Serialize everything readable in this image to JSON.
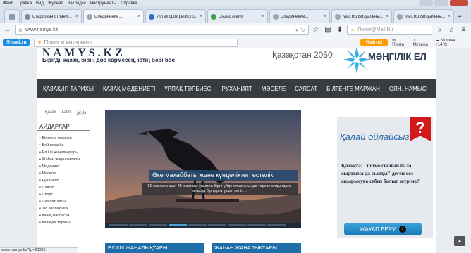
{
  "menubar": {
    "items": [
      "Файл",
      "Правка",
      "Вид",
      "Журнал",
      "Закладки",
      "Инструменты",
      "Справка"
    ]
  },
  "tabs": [
    {
      "label": "Стартовая страниц...",
      "color": "#7a8a9a"
    },
    {
      "label": "Соединение...",
      "color": "#9aa6b4",
      "active": true
    },
    {
      "label": "Истек срок регистр...",
      "color": "#2f6cc4"
    },
    {
      "label": "Qazaq Alemi",
      "color": "#3fa046"
    },
    {
      "label": "Соединение...",
      "color": "#9aa6b4"
    },
    {
      "label": "Mail.Ru Визуальны...",
      "color": "#9aa6b4"
    },
    {
      "label": "Mail.Ru Визуальны...",
      "color": "#9aa6b4"
    }
  ],
  "navbar": {
    "url": "www.namys.kz",
    "search_placeholder": "Поиск@Mail.Ru"
  },
  "mailru": {
    "logo": "@mail.ru",
    "search_placeholder": "Поиск в интернете",
    "find_label": "Найти!",
    "mail_label": "Почта",
    "music_label": "Музыка",
    "weather": "Москва +14°C"
  },
  "site": {
    "logo": "NAMYS.KZ",
    "tagline": "Бірігді, қазақ, бірің дос көрмесең, істің бәрі бос",
    "kz2050": "Қазақстан 2050",
    "star_title": "МӘҢГІЛІК ЕЛ",
    "nav": [
      "ҚАЗАҚИЯ ТАРИХЫ",
      "ҚАЗАҚ МӘДЕНИЕТІ",
      "ҰРПАҚ ТӘРБИЕСІ",
      "РУХАНИЯТ",
      "МӘСЕЛЕ",
      "САЯСАТ",
      "БІЛГЕНГЕ МАРЖАН",
      "ОЯН, НАМЫС"
    ],
    "langs": [
      "Қазақ",
      "Latin",
      "قازاق"
    ],
    "archive_head": "АЙДАРЛАР",
    "sections": [
      "Білгенге маржан",
      "Бейнежазба",
      "Ел іші жаңалықтары",
      "Жаһан жаңалықтары",
      "Мәдениет",
      "Мәселе",
      "Руханият",
      "Саясат",
      "Спорт",
      "Сөз патшасы",
      "Тіл кеплек жоқ",
      "Қазақ баспасөз",
      "Қазақия тарихы"
    ],
    "slide_caption": "Әке махаббаты және күнделіктегі естелік",
    "slide_desc": "80 жастағы шал 45 жастағы ұлымен бірге үйде отырғанында терезе алдындағы ағашқа бір қарға ұшып келіп...",
    "quiz_title": "Қалай ойлайсыз",
    "quiz_mark": "?",
    "quiz_text": "Қазақта: \"ішіме сыйған бала, сыртыма да сыяды\" деген сөз ақырысуға себеп болып жүр ме?",
    "answer_label": "ЖАУАП БЕРУ",
    "news_local": "ЕЛ ІШІ ЖАҢАЛЫҚТАРЫ",
    "news_world": "ЖАҺАН ЖАҢАЛЫҚТАРЫ"
  },
  "statusbar": "www.namys.kz/?p=23085",
  "slider": {
    "dot_count": 9,
    "active_dot": 3
  }
}
